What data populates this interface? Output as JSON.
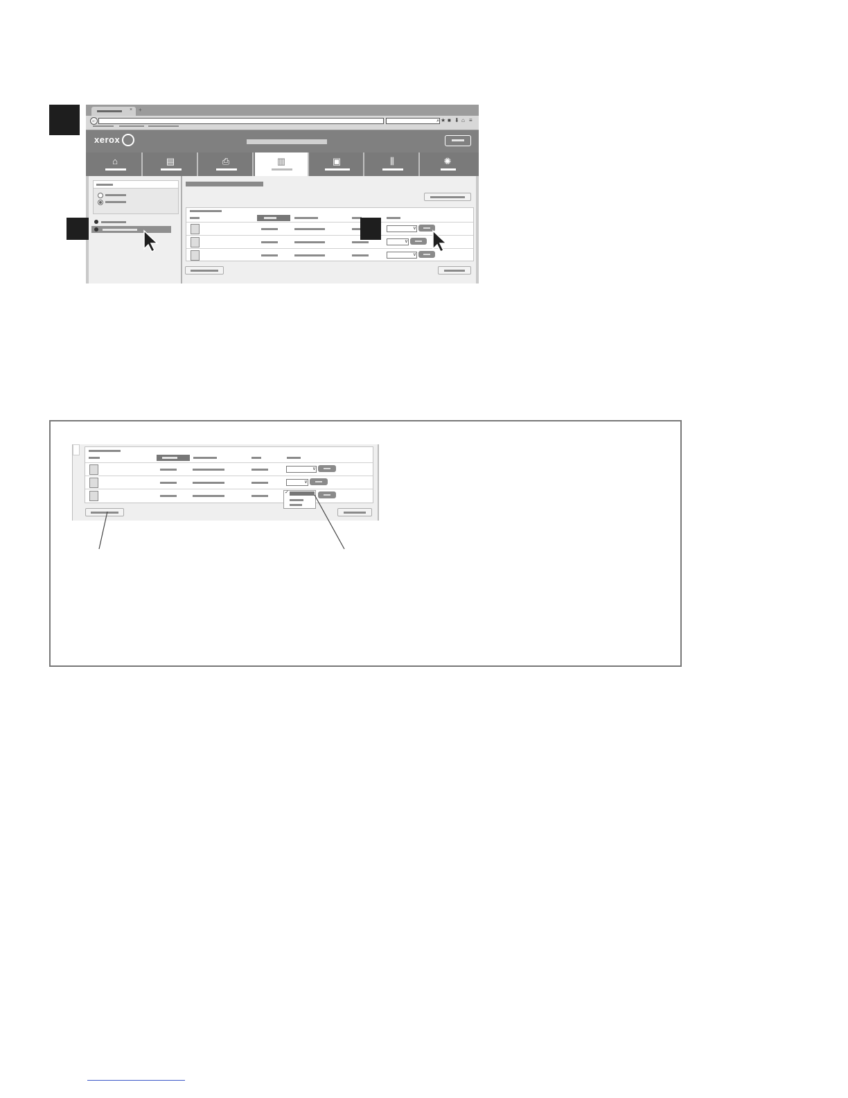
{
  "figure": {
    "step_markers": [
      "",
      "",
      ""
    ],
    "browser": {
      "brand": "xerox",
      "close_glyph": "×",
      "new_tab_glyph": "+",
      "back_glyph": "←",
      "search_glyph": "⌕",
      "toolbar_glyphs": [
        "★",
        "■",
        "⬇",
        "⌂",
        "≡"
      ],
      "nav_icons": [
        "home-icon",
        "tray-icon",
        "printer-icon",
        "jobs-icon",
        "address-book-icon",
        "tools-icon",
        "support-icon"
      ],
      "nav_glyphs": [
        "⌂",
        "▤",
        "⎙",
        "▥",
        "▣",
        "⫼",
        "✺"
      ],
      "active_tab_index": 3,
      "table_rows": 3,
      "dropdown_arrow": "∨"
    },
    "dropdown_check": "✓"
  }
}
